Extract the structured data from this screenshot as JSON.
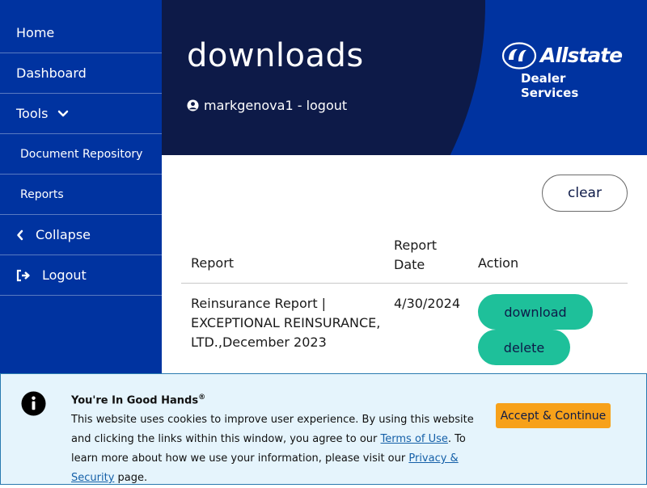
{
  "colors": {
    "sidebar_bg": "#0033a0",
    "header_arc": "#0d1a48",
    "accent_green": "#1ec09a",
    "accept_orange": "#f7a11a",
    "banner_bg": "#e5f4fc"
  },
  "sidebar": {
    "items": [
      {
        "label": "Home",
        "icon": ""
      },
      {
        "label": "Dashboard",
        "icon": ""
      },
      {
        "label": "Tools",
        "icon": "chevron-down-icon"
      },
      {
        "label": "Document Repository",
        "icon": ""
      },
      {
        "label": "Reports",
        "icon": ""
      },
      {
        "label": "Collapse",
        "icon": "chevron-left-icon"
      },
      {
        "label": "Logout",
        "icon": "logout-icon"
      }
    ]
  },
  "header": {
    "title": "downloads",
    "user_text": "markgenova1 - logout",
    "brand_name": "Allstate",
    "brand_sub": "Dealer Services"
  },
  "main": {
    "clear_label": "clear",
    "columns": [
      "Report",
      "Report Date",
      "Action"
    ],
    "rows": [
      {
        "report": "Reinsurance Report | EXCEPTIONAL REINSURANCE, LTD.,December 2023",
        "date": "4/30/2024",
        "download_label": "download",
        "delete_label": "delete"
      }
    ]
  },
  "cookie_banner": {
    "title": "You're In Good Hands",
    "title_mark": "®",
    "text_before_terms": "This website uses cookies to improve user experience. By using this website and clicking the links within this window, you agree to our ",
    "terms_link": "Terms of Use",
    "text_middle": ". To learn more about how we use your information, please visit our ",
    "privacy_link": "Privacy & Security",
    "text_after": " page.",
    "accept_label": "Accept & Continue"
  }
}
